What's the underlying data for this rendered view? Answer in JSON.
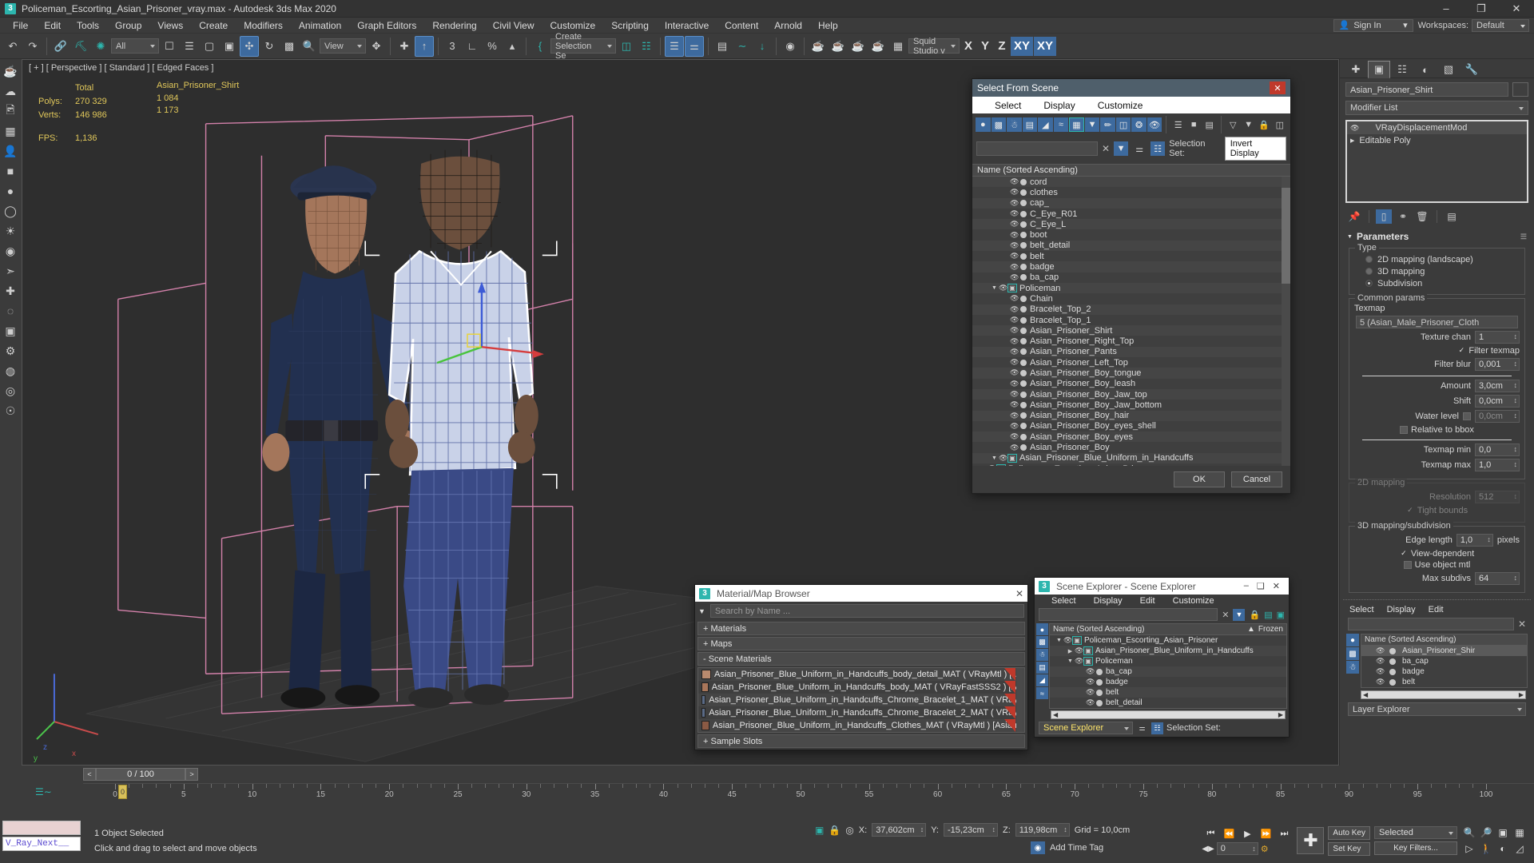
{
  "window": {
    "title": "Policeman_Escorting_Asian_Prisoner_vray.max - Autodesk 3ds Max 2020",
    "app_icon": "3ds-max-icon",
    "minimize": "–",
    "maximize": "❐",
    "close": "✕"
  },
  "menubar": {
    "items": [
      "File",
      "Edit",
      "Tools",
      "Group",
      "Views",
      "Create",
      "Modifiers",
      "Animation",
      "Graph Editors",
      "Rendering",
      "Civil View",
      "Customize",
      "Scripting",
      "Interactive",
      "Content",
      "Arnold",
      "Help"
    ],
    "sign_in": "Sign In",
    "workspaces_label": "Workspaces:",
    "workspace_value": "Default"
  },
  "toolbar": {
    "selection_filter": "All",
    "ref_coord_system": "View",
    "selection_set": "Create Selection Se",
    "renderer_preset": "Squid Studio v",
    "axis_x": "X",
    "axis_y": "Y",
    "axis_z": "Z",
    "axis_xy": "XY",
    "axis_xy2": "XY"
  },
  "viewport": {
    "label": "[ + ] [ Perspective ] [ Standard ] [ Edged Faces ]",
    "stats_col_total": "Total",
    "stats_col_object": "Asian_Prisoner_Shirt",
    "polys_label": "Polys:",
    "polys_total": "270 329",
    "polys_object": "1 084",
    "verts_label": "Verts:",
    "verts_total": "146 986",
    "verts_object": "1 173",
    "fps_label": "FPS:",
    "fps_value": "1,136",
    "axis_x": "x",
    "axis_y": "y",
    "axis_z": "z"
  },
  "select_from_scene": {
    "title": "Select From Scene",
    "close": "✕",
    "menu": [
      "Select",
      "Display",
      "Customize"
    ],
    "search_value": "",
    "clear_icon": "✕",
    "selection_set_label": "Selection Set:",
    "tooltip": "Invert Display",
    "column_header": "Name (Sorted Ascending)",
    "ok": "OK",
    "cancel": "Cancel",
    "tree": [
      {
        "label": "Policeman_Escorting_Asian_Prisoner",
        "depth": 0,
        "type": "group",
        "expanded": true
      },
      {
        "label": "Asian_Prisoner_Blue_Uniform_in_Handcuffs",
        "depth": 1,
        "type": "group",
        "expanded": true
      },
      {
        "label": "Asian_Prisoner_Boy",
        "depth": 2,
        "type": "mesh"
      },
      {
        "label": "Asian_Prisoner_Boy_eyes",
        "depth": 2,
        "type": "mesh"
      },
      {
        "label": "Asian_Prisoner_Boy_eyes_shell",
        "depth": 2,
        "type": "mesh"
      },
      {
        "label": "Asian_Prisoner_Boy_hair",
        "depth": 2,
        "type": "mesh"
      },
      {
        "label": "Asian_Prisoner_Boy_Jaw_bottom",
        "depth": 2,
        "type": "mesh"
      },
      {
        "label": "Asian_Prisoner_Boy_Jaw_top",
        "depth": 2,
        "type": "mesh"
      },
      {
        "label": "Asian_Prisoner_Boy_leash",
        "depth": 2,
        "type": "mesh"
      },
      {
        "label": "Asian_Prisoner_Boy_tongue",
        "depth": 2,
        "type": "mesh"
      },
      {
        "label": "Asian_Prisoner_Left_Top",
        "depth": 2,
        "type": "mesh"
      },
      {
        "label": "Asian_Prisoner_Pants",
        "depth": 2,
        "type": "mesh"
      },
      {
        "label": "Asian_Prisoner_Right_Top",
        "depth": 2,
        "type": "mesh"
      },
      {
        "label": "Asian_Prisoner_Shirt",
        "depth": 2,
        "type": "mesh"
      },
      {
        "label": "Bracelet_Top_1",
        "depth": 2,
        "type": "mesh"
      },
      {
        "label": "Bracelet_Top_2",
        "depth": 2,
        "type": "mesh"
      },
      {
        "label": "Chain",
        "depth": 2,
        "type": "mesh"
      },
      {
        "label": "Policeman",
        "depth": 1,
        "type": "group",
        "expanded": true
      },
      {
        "label": "ba_cap",
        "depth": 2,
        "type": "mesh"
      },
      {
        "label": "badge",
        "depth": 2,
        "type": "mesh"
      },
      {
        "label": "belt",
        "depth": 2,
        "type": "mesh"
      },
      {
        "label": "belt_detail",
        "depth": 2,
        "type": "mesh"
      },
      {
        "label": "boot",
        "depth": 2,
        "type": "mesh"
      },
      {
        "label": "C_Eye_L",
        "depth": 2,
        "type": "mesh"
      },
      {
        "label": "C_Eye_R01",
        "depth": 2,
        "type": "mesh"
      },
      {
        "label": "cap_",
        "depth": 2,
        "type": "mesh"
      },
      {
        "label": "clothes",
        "depth": 2,
        "type": "mesh"
      },
      {
        "label": "cord",
        "depth": 2,
        "type": "mesh"
      }
    ]
  },
  "material_browser": {
    "title": "Material/Map Browser",
    "app_icon": "3ds-max-icon",
    "close": "✕",
    "search_placeholder": "Search by Name ...",
    "groups": [
      {
        "label": "+ Materials"
      },
      {
        "label": "+ Maps"
      },
      {
        "label": "- Scene Materials"
      }
    ],
    "sample_slots": "+ Sample Slots",
    "materials": [
      {
        "name": "Asian_Prisoner_Blue_Uniform_in_Handcuffs_body_detail_MAT ( VRayMtl ) [...",
        "swatch": "#b98a6e"
      },
      {
        "name": "Asian_Prisoner_Blue_Uniform_in_Handcuffs_body_MAT ( VRayFastSSS2 ) [A...",
        "swatch": "#a9765a"
      },
      {
        "name": "Asian_Prisoner_Blue_Uniform_in_Handcuffs_Chrome_Bracelet_1_MAT ( VRay...",
        "swatch": "#5a6a86"
      },
      {
        "name": "Asian_Prisoner_Blue_Uniform_in_Handcuffs_Chrome_Bracelet_2_MAT ( VRay...",
        "swatch": "#5a6a86"
      },
      {
        "name": "Asian_Prisoner_Blue_Uniform_in_Handcuffs_Clothes_MAT ( VRayMtl ) [Asian...",
        "swatch": "#8a5a44"
      }
    ]
  },
  "scene_explorer": {
    "title": "Scene Explorer - Scene Explorer",
    "app_icon": "3ds-max-icon",
    "minimize": "–",
    "maximize": "❑",
    "close": "✕",
    "menu": [
      "Select",
      "Display",
      "Edit",
      "Customize"
    ],
    "search_value": "",
    "column_name": "Name (Sorted Ascending)",
    "column_frozen": "Frozen",
    "sort_arrow": "▲",
    "combo_value": "Scene Explorer",
    "selection_set_label": "Selection Set:",
    "rows": [
      {
        "label": "Policeman_Escorting_Asian_Prisoner",
        "depth": 0,
        "type": "group",
        "expanded": true
      },
      {
        "label": "Asian_Prisoner_Blue_Uniform_in_Handcuffs",
        "depth": 1,
        "type": "group",
        "expanded": false
      },
      {
        "label": "Policeman",
        "depth": 1,
        "type": "group",
        "expanded": true
      },
      {
        "label": "ba_cap",
        "depth": 2,
        "type": "mesh"
      },
      {
        "label": "badge",
        "depth": 2,
        "type": "mesh"
      },
      {
        "label": "belt",
        "depth": 2,
        "type": "mesh"
      },
      {
        "label": "belt_detail",
        "depth": 2,
        "type": "mesh"
      }
    ]
  },
  "command_panel": {
    "tabs": [
      "create-tab",
      "modify-tab",
      "hierarchy-tab",
      "motion-tab",
      "display-tab",
      "utilities-tab"
    ],
    "selected_tab_index": 1,
    "object_name": "Asian_Prisoner_Shirt",
    "modifier_list_label": "Modifier List",
    "modifier_stack": [
      {
        "label": "VRayDisplacementMod",
        "selected": true
      },
      {
        "label": "Editable Poly",
        "selected": false
      }
    ],
    "rollout_title": "Parameters",
    "type_group": "Type",
    "type_options": [
      {
        "label": "2D mapping (landscape)",
        "selected": false
      },
      {
        "label": "3D mapping",
        "selected": false
      },
      {
        "label": "Subdivision",
        "selected": true
      }
    ],
    "common_group": "Common params",
    "texmap_label": "Texmap",
    "texmap_value": "5 (Asian_Male_Prisoner_Cloth",
    "texture_chan_label": "Texture chan",
    "texture_chan_value": "1",
    "filter_texmap_label": "Filter texmap",
    "filter_texmap_checked": true,
    "filter_blur_label": "Filter blur",
    "filter_blur_value": "0,001",
    "amount_label": "Amount",
    "amount_value": "3,0cm",
    "shift_label": "Shift",
    "shift_value": "0,0cm",
    "water_level_label": "Water level",
    "water_level_value": "0,0cm",
    "relative_bbox_label": "Relative to bbox",
    "texmap_min_label": "Texmap min",
    "texmap_min_value": "0,0",
    "texmap_max_label": "Texmap max",
    "texmap_max_value": "1,0",
    "mapping2d_group": "2D mapping",
    "resolution_label": "Resolution",
    "resolution_value": "512",
    "tight_bounds_label": "Tight bounds",
    "mapping3d_group": "3D mapping/subdivision",
    "edge_length_label": "Edge length",
    "edge_length_value": "1,0",
    "edge_length_units": "pixels",
    "view_dependent_label": "View-dependent",
    "use_object_mtl_label": "Use object mtl",
    "max_subdivs_label": "Max subdivs",
    "max_subdivs_value": "64",
    "mini_explorer": {
      "menu": [
        "Select",
        "Display",
        "Edit"
      ],
      "search_value": "",
      "column_name": "Name (Sorted Ascending)",
      "rows": [
        {
          "label": "Asian_Prisoner_Shir",
          "selected": true
        },
        {
          "label": "ba_cap",
          "selected": false
        },
        {
          "label": "badge",
          "selected": false
        },
        {
          "label": "belt",
          "selected": false
        }
      ],
      "layer_explorer": "Layer Explorer"
    }
  },
  "timeline": {
    "prev_frame": "<",
    "next_frame": ">",
    "frame_display": "0 / 100",
    "ticks": [
      "0",
      "5",
      "10",
      "15",
      "20",
      "25",
      "30",
      "35",
      "40",
      "45",
      "50",
      "55",
      "60",
      "65",
      "70",
      "75",
      "80",
      "85",
      "90",
      "95",
      "100"
    ],
    "current_frame_label": "0"
  },
  "status_bar": {
    "mini_listener_name": "V_Ray_Next__",
    "selection_status": "1 Object Selected",
    "prompt": "Click and drag to select and move objects",
    "x_label": "X:",
    "x_value": "37,602cm",
    "y_label": "Y:",
    "y_value": "-15,23cm",
    "z_label": "Z:",
    "z_value": "119,98cm",
    "grid_label": "Grid = 10,0cm",
    "add_time_tag": "Add Time Tag",
    "auto_key": "Auto Key",
    "set_key": "Set Key",
    "key_mode": "Selected",
    "key_filters": "Key Filters...",
    "frame_value": "0"
  }
}
